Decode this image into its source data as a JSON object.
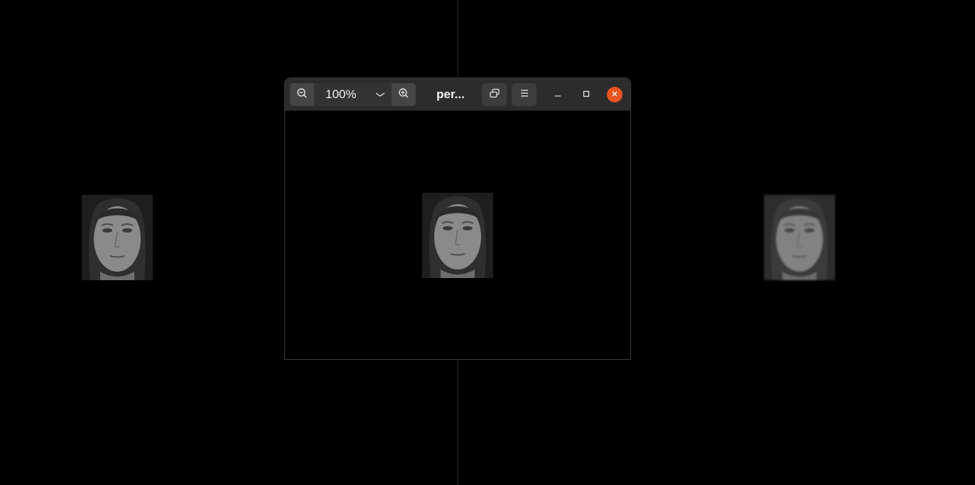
{
  "viewer": {
    "title": "per...",
    "zoom_level": "100%"
  },
  "icons": {
    "zoom_out": "zoom-out-icon",
    "zoom_in": "zoom-in-icon",
    "zoom_dropdown": "chevron-down-icon",
    "gallery": "gallery-icon",
    "menu": "hamburger-menu-icon",
    "minimize": "minimize-icon",
    "maximize": "maximize-icon",
    "close": "close-icon"
  },
  "colors": {
    "desktop_background": "#000000",
    "headerbar": "#2c2c2c",
    "close_button": "#e95420",
    "button": "#3d3d3d"
  }
}
